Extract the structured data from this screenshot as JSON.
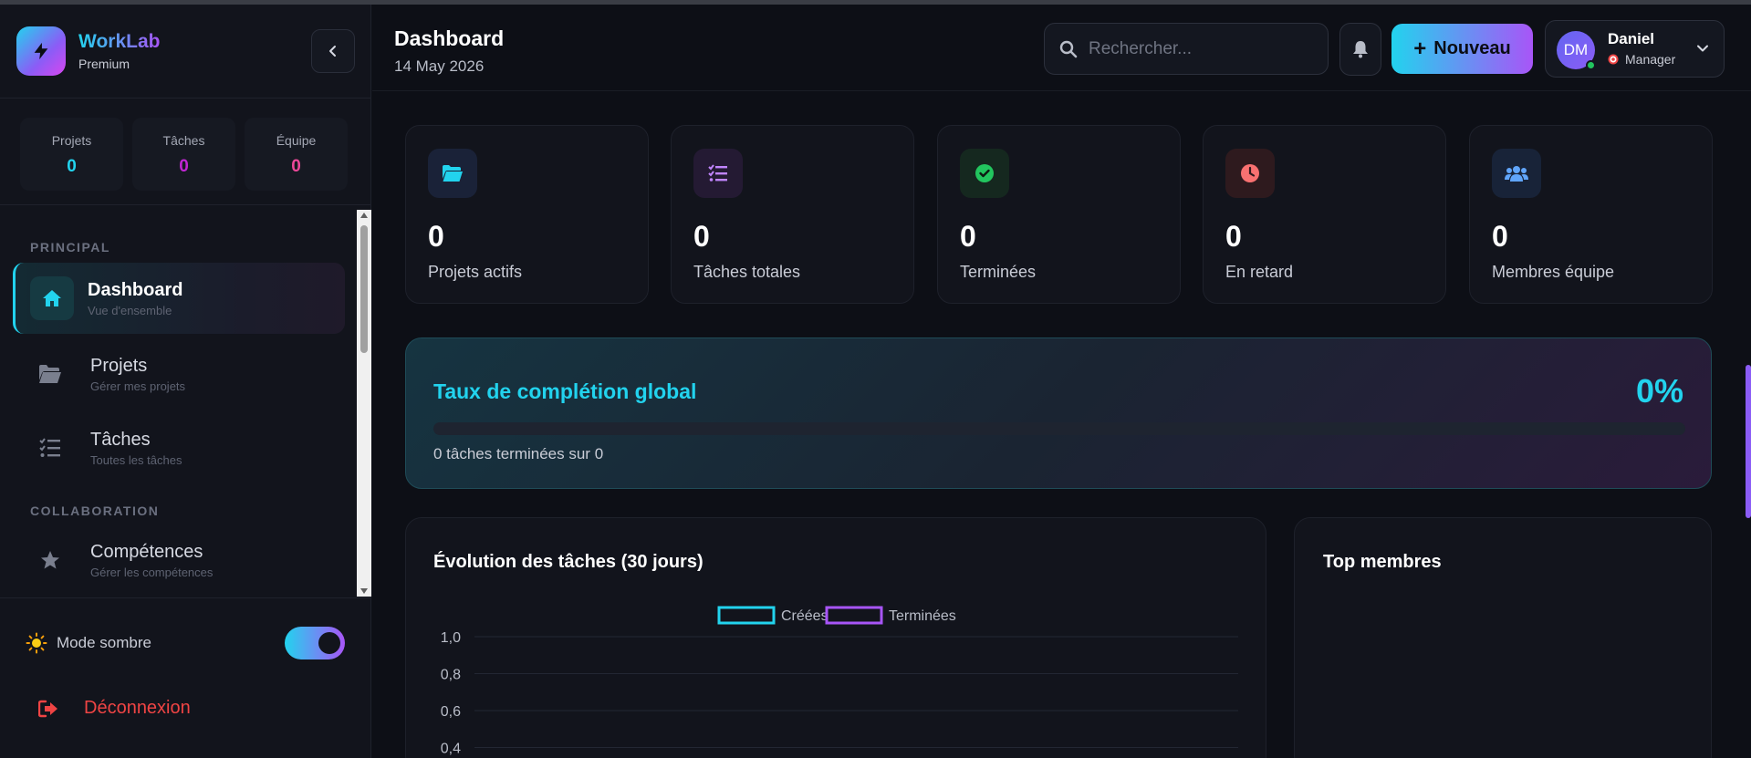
{
  "brand": {
    "name": "WorkLab",
    "plan": "Premium"
  },
  "mini_stats": [
    {
      "label": "Projets",
      "value": "0",
      "color": "#22d3ee"
    },
    {
      "label": "Tâches",
      "value": "0",
      "color": "#c026d3"
    },
    {
      "label": "Équipe",
      "value": "0",
      "color": "#ec4899"
    }
  ],
  "nav": {
    "sections": {
      "principal": "PRINCIPAL",
      "collaboration": "COLLABORATION"
    },
    "items": [
      {
        "title": "Dashboard",
        "subtitle": "Vue d'ensemble",
        "icon": "home-icon",
        "active": true
      },
      {
        "title": "Projets",
        "subtitle": "Gérer mes projets",
        "icon": "folder-icon"
      },
      {
        "title": "Tâches",
        "subtitle": "Toutes les tâches",
        "icon": "tasks-icon"
      },
      {
        "title": "Compétences",
        "subtitle": "Gérer les compétences",
        "icon": "star-icon"
      }
    ]
  },
  "theme": {
    "label": "Mode sombre",
    "enabled": true
  },
  "logout": {
    "label": "Déconnexion"
  },
  "header": {
    "title": "Dashboard",
    "date": "14 May 2026",
    "search_placeholder": "Rechercher...",
    "new_button": "Nouveau",
    "user": {
      "initials": "DM",
      "name": "Daniel",
      "role": "Manager"
    }
  },
  "stats": [
    {
      "value": "0",
      "label": "Projets actifs",
      "icon": "folder-open-icon",
      "color": "#22d3ee"
    },
    {
      "value": "0",
      "label": "Tâches totales",
      "icon": "list-check-icon",
      "color": "#c084fc"
    },
    {
      "value": "0",
      "label": "Terminées",
      "icon": "check-circle-icon",
      "color": "#22c55e"
    },
    {
      "value": "0",
      "label": "En retard",
      "icon": "clock-icon",
      "color": "#f87171"
    },
    {
      "value": "0",
      "label": "Membres équipe",
      "icon": "users-icon",
      "color": "#60a5fa"
    }
  ],
  "completion": {
    "title": "Taux de complétion global",
    "percent_label": "0%",
    "progress": 0,
    "subtitle": "0 tâches terminées sur 0"
  },
  "chart_data": {
    "type": "line",
    "title": "Évolution des tâches (30 jours)",
    "series": [
      {
        "name": "Créées",
        "color": "#22d3ee",
        "values": []
      },
      {
        "name": "Terminées",
        "color": "#a855f7",
        "values": []
      }
    ],
    "y_ticks": [
      "1,0",
      "0,8",
      "0,6",
      "0,4"
    ],
    "ylim": [
      0,
      1
    ],
    "grid": true,
    "legend": "top-center"
  },
  "members": {
    "title": "Top membres"
  }
}
